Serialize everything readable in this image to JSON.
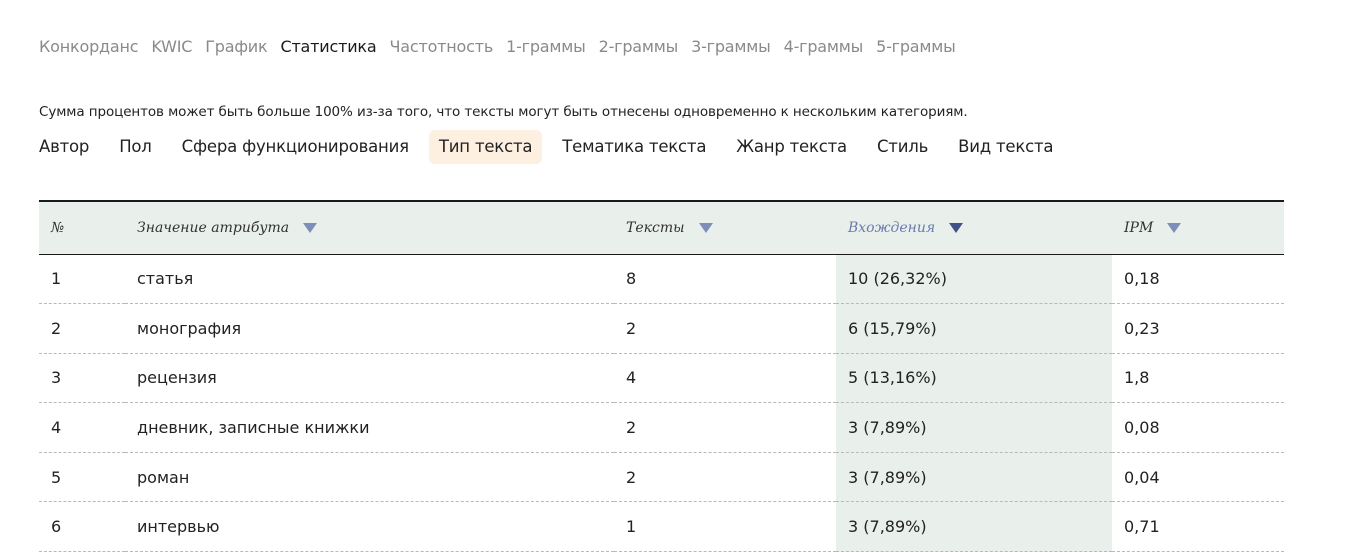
{
  "nav": {
    "tabs": [
      {
        "label": "Конкорданс",
        "active": false
      },
      {
        "label": "KWIC",
        "active": false
      },
      {
        "label": "График",
        "active": false
      },
      {
        "label": "Статистика",
        "active": true
      },
      {
        "label": "Частотность",
        "active": false
      },
      {
        "label": "1-граммы",
        "active": false
      },
      {
        "label": "2-граммы",
        "active": false
      },
      {
        "label": "3-граммы",
        "active": false
      },
      {
        "label": "4-граммы",
        "active": false
      },
      {
        "label": "5-граммы",
        "active": false
      }
    ]
  },
  "note": "Сумма процентов может быть больше 100% из-за того, что тексты могут быть отнесены одновременно к нескольким категориям.",
  "attribute_tabs": [
    {
      "label": "Автор",
      "active": false
    },
    {
      "label": "Пол",
      "active": false
    },
    {
      "label": "Сфера функционирования",
      "active": false
    },
    {
      "label": "Тип текста",
      "active": true
    },
    {
      "label": "Тематика текста",
      "active": false
    },
    {
      "label": "Жанр текста",
      "active": false
    },
    {
      "label": "Стиль",
      "active": false
    },
    {
      "label": "Вид текста",
      "active": false
    }
  ],
  "table": {
    "headers": {
      "num": "№",
      "value": "Значение атрибута",
      "texts": "Тексты",
      "occurrences": "Вхождения",
      "ipm": "IPM"
    },
    "sorted_column": "occurrences",
    "rows": [
      {
        "num": "1",
        "value": "статья",
        "texts": "8",
        "occurrences": "10 (26,32%)",
        "ipm": "0,18"
      },
      {
        "num": "2",
        "value": "монография",
        "texts": "2",
        "occurrences": "6 (15,79%)",
        "ipm": "0,23"
      },
      {
        "num": "3",
        "value": "рецензия",
        "texts": "4",
        "occurrences": "5 (13,16%)",
        "ipm": "1,8"
      },
      {
        "num": "4",
        "value": "дневник, записные книжки",
        "texts": "2",
        "occurrences": "3 (7,89%)",
        "ipm": "0,08"
      },
      {
        "num": "5",
        "value": "роман",
        "texts": "2",
        "occurrences": "3 (7,89%)",
        "ipm": "0,04"
      },
      {
        "num": "6",
        "value": "интервью",
        "texts": "1",
        "occurrences": "3 (7,89%)",
        "ipm": "0,71"
      }
    ]
  },
  "colors": {
    "active_tab_bg": "#fdf0e0",
    "table_highlight": "#e9efeb",
    "sort_arrow": "#7f8db9",
    "sorted_header": "#6a7bb0"
  }
}
